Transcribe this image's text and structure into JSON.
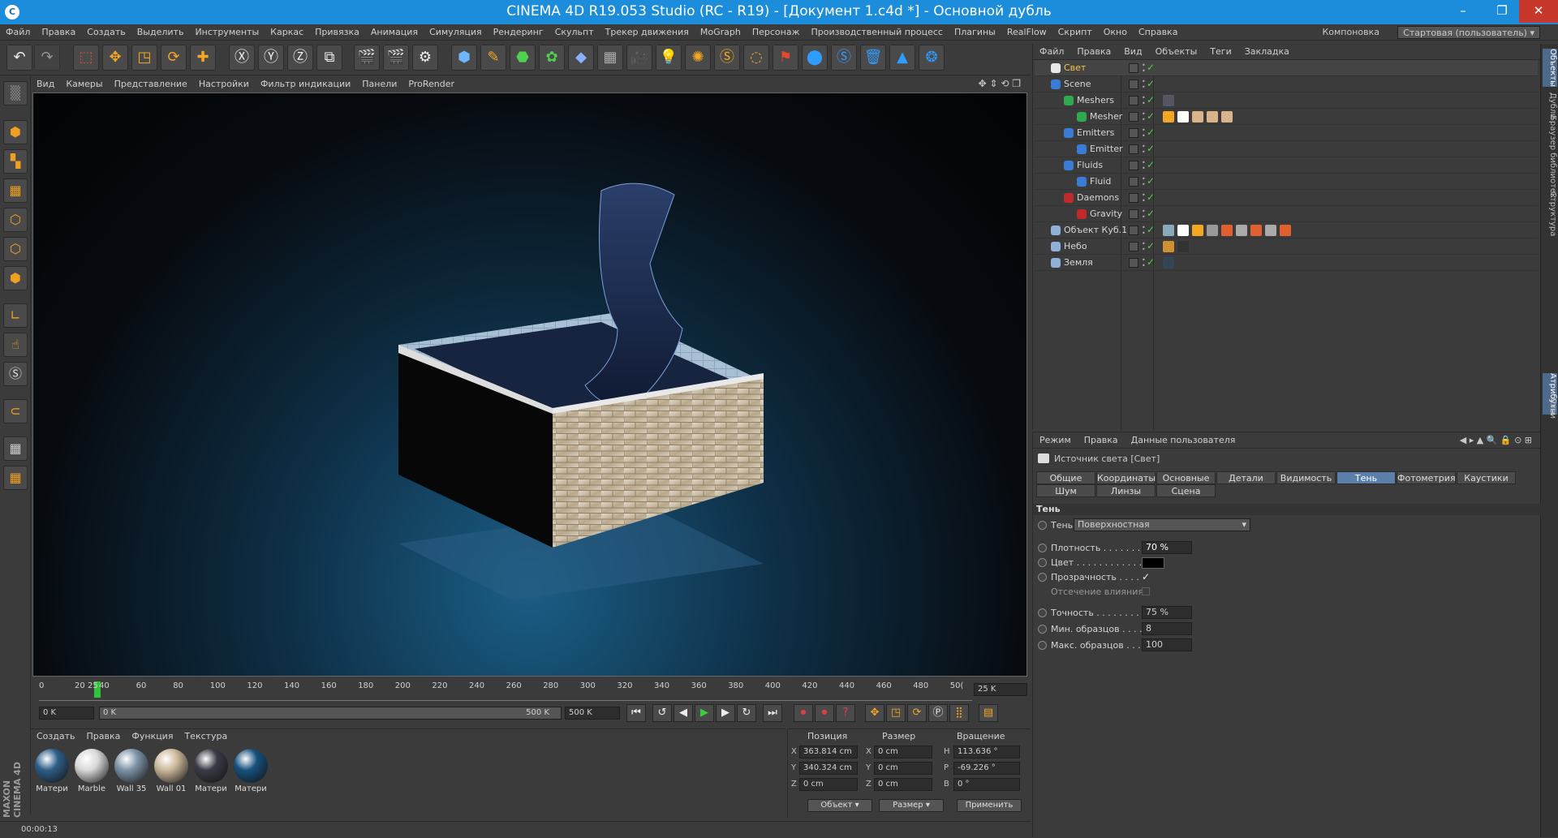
{
  "window": {
    "title": "CINEMA 4D R19.053 Studio (RC - R19) - [Документ 1.c4d *] - Основной дубль",
    "minimize": "–",
    "maximize": "❐",
    "close": "✕"
  },
  "menu": [
    "Файл",
    "Правка",
    "Создать",
    "Выделить",
    "Инструменты",
    "Каркас",
    "Привязка",
    "Анимация",
    "Симуляция",
    "Рендеринг",
    "Скульпт",
    "Трекер движения",
    "MoGraph",
    "Персонаж",
    "Производственный процесс",
    "Плагины",
    "RealFlow",
    "Скрипт",
    "Окно",
    "Справка"
  ],
  "layout": {
    "label": "Компоновка",
    "value": "Стартовая (пользователь)"
  },
  "viewport_menu": [
    "Вид",
    "Камеры",
    "Представление",
    "Настройки",
    "Фильтр индикации",
    "Панели",
    "ProRender"
  ],
  "timeline": {
    "ticks": [
      "0",
      "20",
      "25",
      "40",
      "60",
      "80",
      "100",
      "120",
      "140",
      "160",
      "180",
      "200",
      "220",
      "240",
      "260",
      "280",
      "300",
      "320",
      "340",
      "360",
      "380",
      "400",
      "420",
      "440",
      "460",
      "480",
      "50("
    ],
    "end_label": "25 K",
    "current_frame": 25
  },
  "transport": {
    "start": "0 K",
    "range_start": "0 K",
    "range_end": "500 K",
    "end": "500 K"
  },
  "material_manager": {
    "menu": [
      "Создать",
      "Правка",
      "Функция",
      "Текстура"
    ],
    "materials": [
      {
        "label": "Матери",
        "color": "#2d5d86"
      },
      {
        "label": "Marble",
        "color": "#d9d9d9"
      },
      {
        "label": "Wall 35",
        "color": "#7c93a7"
      },
      {
        "label": "Wall 01",
        "color": "#cbb89a"
      },
      {
        "label": "Матери",
        "color": "#3a3a46"
      },
      {
        "label": "Матери",
        "color": "#16507c"
      }
    ]
  },
  "coords": {
    "headers": [
      "Позиция",
      "Размер",
      "Вращение"
    ],
    "rows": [
      {
        "axis": "X",
        "pos": "363.814 cm",
        "size_axis": "X",
        "size": "0 cm",
        "rot_axis": "H",
        "rot": "113.636 °"
      },
      {
        "axis": "Y",
        "pos": "340.324 cm",
        "size_axis": "Y",
        "size": "0 cm",
        "rot_axis": "P",
        "rot": "-69.226 °"
      },
      {
        "axis": "Z",
        "pos": "0 cm",
        "size_axis": "Z",
        "size": "0 cm",
        "rot_axis": "B",
        "rot": "0 °"
      }
    ],
    "mode": "Объект",
    "size_mode": "Размер",
    "apply": "Применить"
  },
  "status": {
    "time": "00:00:13"
  },
  "logo": "MAXON CINEMA 4D",
  "object_manager": {
    "menu": [
      "Файл",
      "Правка",
      "Вид",
      "Объекты",
      "Теги",
      "Закладка"
    ],
    "objects": [
      {
        "name": "Свет",
        "indent": 0,
        "color": "#e8e8e8",
        "selected": true
      },
      {
        "name": "Scene",
        "indent": 0,
        "color": "#3a7bd5"
      },
      {
        "name": "Meshers",
        "indent": 1,
        "color": "#2fa84f"
      },
      {
        "name": "Mesher",
        "indent": 2,
        "color": "#2fa84f"
      },
      {
        "name": "Emitters",
        "indent": 1,
        "color": "#3a7bd5"
      },
      {
        "name": "Emitter",
        "indent": 2,
        "color": "#3a7bd5"
      },
      {
        "name": "Fluids",
        "indent": 1,
        "color": "#3a7bd5"
      },
      {
        "name": "Fluid",
        "indent": 2,
        "color": "#3a7bd5"
      },
      {
        "name": "Daemons",
        "indent": 1,
        "color": "#c02a2a"
      },
      {
        "name": "Gravity",
        "indent": 2,
        "color": "#c02a2a"
      },
      {
        "name": "Объект Куб.1",
        "indent": 0,
        "color": "#8fb0d8"
      },
      {
        "name": "Небо",
        "indent": 0,
        "color": "#8fb0d8"
      },
      {
        "name": "Земля",
        "indent": 0,
        "color": "#8fb0d8"
      }
    ]
  },
  "side_tabs": [
    "Объекты",
    "Дубли",
    "Браузер библиотек",
    "Структура",
    "Атрибуты",
    "Слои"
  ],
  "attributes": {
    "menu": [
      "Режим",
      "Правка",
      "Данные пользователя"
    ],
    "object_title": "Источник света [Свет]",
    "tabs_row1": [
      "Общие",
      "Координаты",
      "Основные",
      "Детали",
      "Видимость",
      "Тень",
      "Фотометрия",
      "Каустики"
    ],
    "tabs_row2": [
      "Шум",
      "Линзы",
      "Сцена"
    ],
    "active_tab": "Тень",
    "section": "Тень",
    "shadow_label": "Тень",
    "shadow_type": "Поверхностная",
    "density_label": "Плотность . . . . . . . .",
    "density": "70 %",
    "color_label": "Цвет . . . . . . . . . . . .",
    "transparency_label": "Прозрачность . . . .",
    "clip_label": "Отсечение влияния",
    "accuracy_label": "Точность . . . . . . . .",
    "accuracy": "75 %",
    "min_samples_label": "Мин. образцов . . . .",
    "min_samples": "8",
    "max_samples_label": "Макс. образцов . . .",
    "max_samples": "100"
  }
}
